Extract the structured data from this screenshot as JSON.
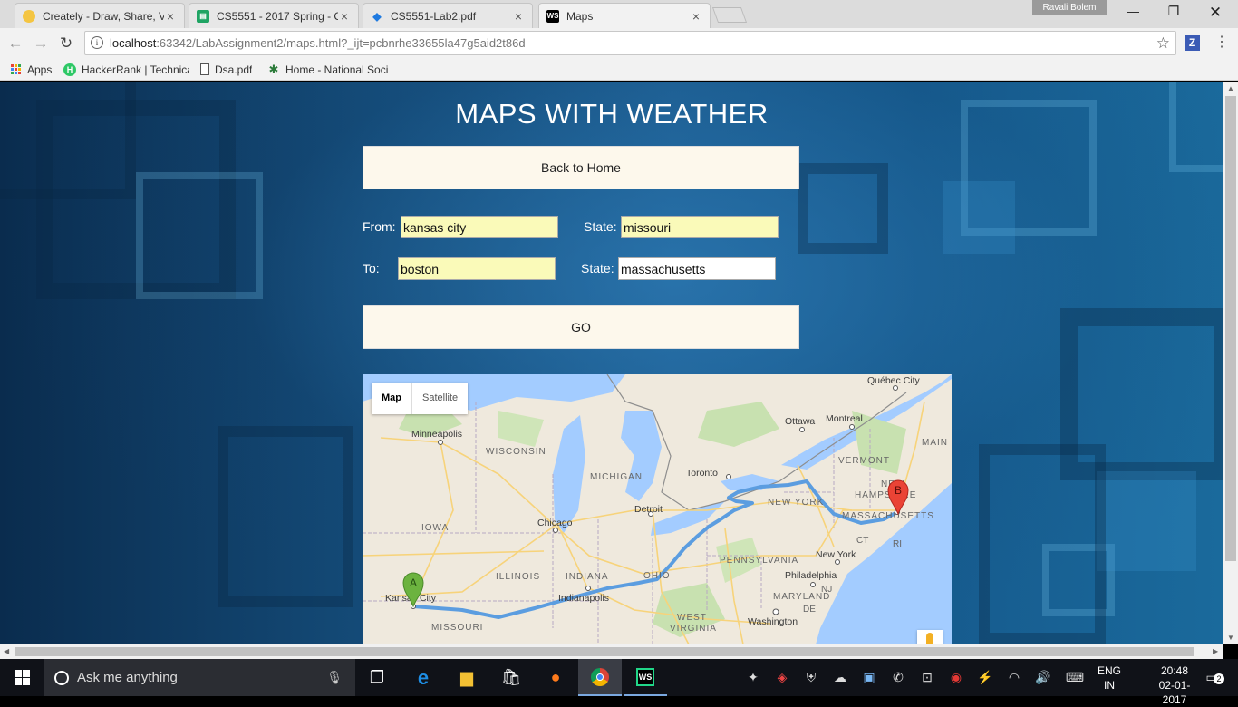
{
  "browser": {
    "tabs": [
      {
        "title": "Creately - Draw, Share, V",
        "icon": "creately-icon",
        "color": "#f4c542"
      },
      {
        "title": "CS5551 - 2017 Spring - C",
        "icon": "sheets-icon",
        "color": "#1fa463"
      },
      {
        "title": "CS5551-Lab2.pdf",
        "icon": "dropbox-icon",
        "color": "#1f7ae0"
      },
      {
        "title": "Maps",
        "icon": "webstorm-icon",
        "color": "#000000"
      }
    ],
    "profile_name": "Ravali Bolem",
    "url_host": "localhost",
    "url_rest": ":63342/LabAssignment2/maps.html?_ijt=pcbnrhe33655la47g5aid2t86d",
    "extension_label": "Z",
    "bookmarks": [
      {
        "label": "Apps",
        "icon": "apps-grid-icon"
      },
      {
        "label": "HackerRank | Technica",
        "icon": "hackerrank-icon"
      },
      {
        "label": "Dsa.pdf",
        "icon": "file-icon"
      },
      {
        "label": "Home - National Soci",
        "icon": "society-icon"
      }
    ]
  },
  "page": {
    "title": "MAPS WITH WEATHER",
    "back_button": "Back to Home",
    "from_label": "From:",
    "from_value": "kansas city",
    "from_state_label": "State:",
    "from_state_value": "missouri",
    "to_label": "To:",
    "to_value": "boston",
    "to_state_label": "State:",
    "to_state_value": "massachusetts",
    "go_button": "GO"
  },
  "map": {
    "type_map": "Map",
    "type_satellite": "Satellite",
    "marker_a": "A",
    "marker_b": "B",
    "labels": {
      "quebec": "Québec City",
      "ottawa": "Ottawa",
      "montreal": "Montreal",
      "maine": "MAIN",
      "minneapolis": "Minneapolis",
      "wisconsin": "WISCONSIN",
      "michigan": "MICHIGAN",
      "vermont": "VERMONT",
      "toronto": "Toronto",
      "new_hampshire_1": "NEW",
      "new_hampshire_2": "HAMPSHIRE",
      "detroit": "Detroit",
      "new_york_state": "NEW YORK",
      "massachusetts": "MASSACHUSETTS",
      "iowa": "IOWA",
      "chicago": "Chicago",
      "ct": "CT",
      "ri": "RI",
      "new_york_city": "New York",
      "pennsylvania": "PENNSYLVANIA",
      "illinois": "ILLINOIS",
      "indiana": "INDIANA",
      "ohio": "OHIO",
      "philadelphia": "Philadelphia",
      "nj": "NJ",
      "kansas_city": "Kansas City",
      "indianapolis": "Indianapolis",
      "maryland": "MARYLAND",
      "de": "DE",
      "west_virginia_1": "WEST",
      "west_virginia_2": "VIRGINIA",
      "washington": "Washington",
      "missouri": "MISSOURI"
    }
  },
  "taskbar": {
    "search_placeholder": "Ask me anything",
    "lang_1": "ENG",
    "lang_2": "IN",
    "time": "20:48",
    "date": "02-01-2017",
    "notifications": "2"
  },
  "colors": {
    "route": "#5b9de0",
    "marker_a": "#6cb33f",
    "marker_b": "#ea4335",
    "water": "#a3ccff",
    "land": "#efe9dd",
    "button_bg": "#fdf8ec",
    "input_autofill": "#fafab9"
  }
}
